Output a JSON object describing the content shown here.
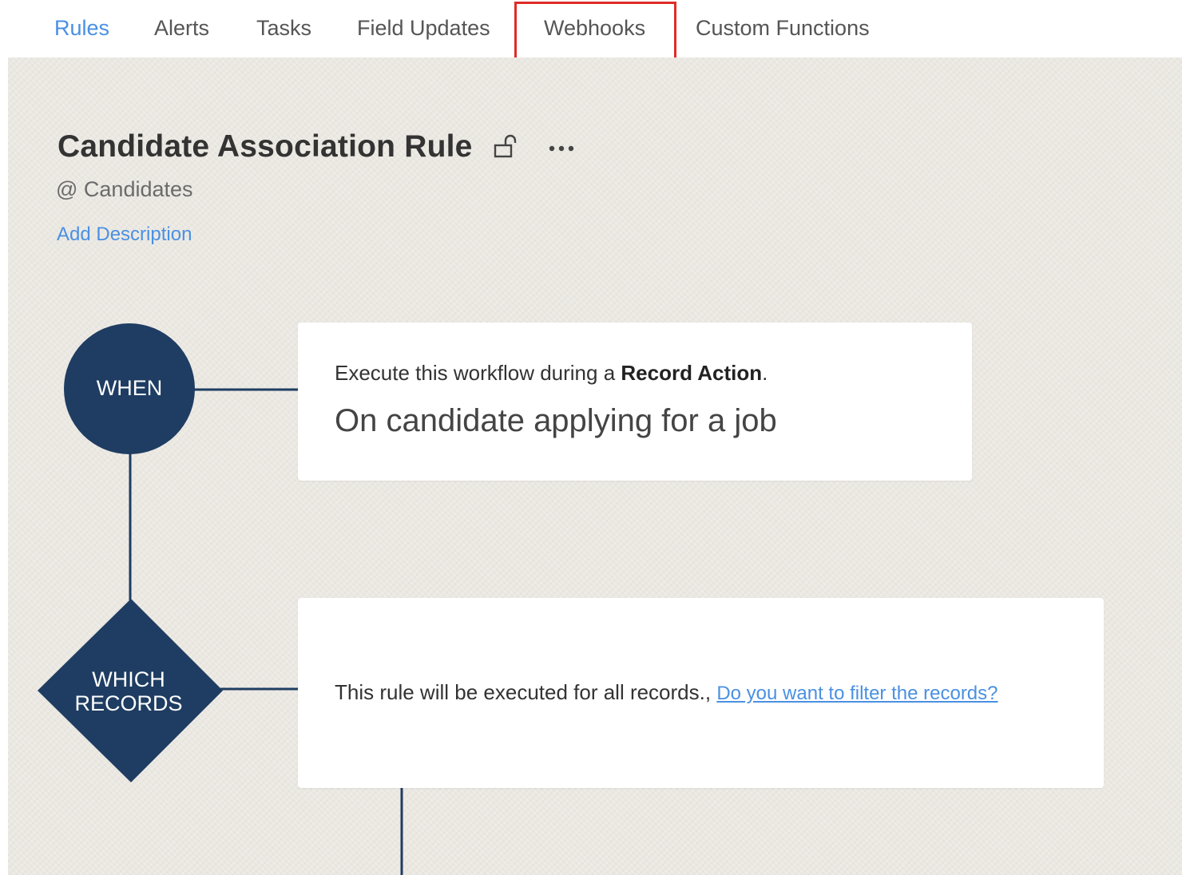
{
  "tabs": [
    {
      "label": "Rules",
      "active": true
    },
    {
      "label": "Alerts",
      "active": false
    },
    {
      "label": "Tasks",
      "active": false
    },
    {
      "label": "Field Updates",
      "active": false
    },
    {
      "label": "Webhooks",
      "active": false,
      "highlighted": true
    },
    {
      "label": "Custom Functions",
      "active": false
    }
  ],
  "rule": {
    "title": "Candidate Association Rule",
    "module": "@ Candidates",
    "add_description": "Add Description",
    "lock_icon": "unlock-icon",
    "more_icon": "more-horizontal-icon"
  },
  "flow": {
    "when": {
      "node_label": "WHEN",
      "intro_prefix": "Execute this workflow during a ",
      "intro_bold": "Record Action",
      "intro_suffix": ".",
      "trigger": "On candidate applying for a job"
    },
    "which_records": {
      "node_label_line1": "WHICH",
      "node_label_line2": "RECORDS",
      "text": "This rule will be executed for all records.,",
      "filter_link": "Do you want to filter the records?"
    }
  },
  "colors": {
    "accent": "#4a90e2",
    "node": "#1f3d62",
    "highlight": "#e02b27",
    "canvas": "#ebe8e2"
  }
}
